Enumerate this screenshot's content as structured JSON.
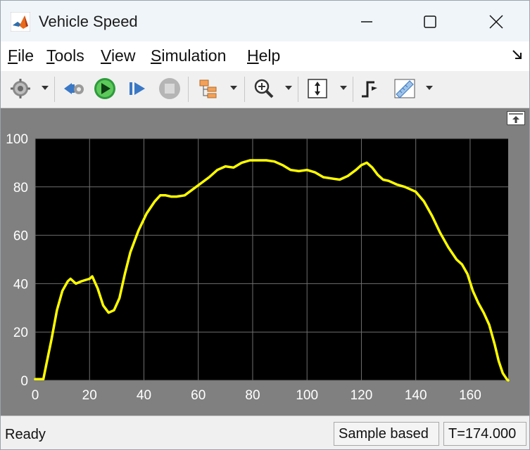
{
  "window": {
    "title": "Vehicle Speed"
  },
  "menu": [
    {
      "pre": "",
      "key": "F",
      "post": "ile"
    },
    {
      "pre": "",
      "key": "T",
      "post": "ools"
    },
    {
      "pre": "",
      "key": "V",
      "post": "iew"
    },
    {
      "pre": "",
      "key": "S",
      "post": "imulation"
    },
    {
      "pre": "",
      "key": "H",
      "post": "elp"
    }
  ],
  "toolbar": {
    "items": [
      "gear-icon",
      "step-back-icon",
      "run-icon",
      "step-forward-icon",
      "stop-icon",
      "signal-hierarchy-icon",
      "zoom-icon",
      "autoscale-icon",
      "trigger-icon",
      "measure-icon"
    ]
  },
  "status": {
    "ready": "Ready",
    "sample": "Sample based",
    "time": "T=174.000"
  },
  "colors": {
    "trace": "#ffff00",
    "plot_bg": "#000000",
    "scope_bg": "#808080",
    "grid": "#6f6f6f"
  },
  "chart_data": {
    "type": "line",
    "title": "",
    "xlabel": "",
    "ylabel": "",
    "xlim": [
      0,
      174
    ],
    "ylim": [
      0,
      100
    ],
    "xticks": [
      0,
      20,
      40,
      60,
      80,
      100,
      120,
      140,
      160
    ],
    "yticks": [
      0,
      20,
      40,
      60,
      80,
      100
    ],
    "grid": true,
    "series": [
      {
        "x": [
          0,
          3,
          4,
          6,
          8,
          10,
          12,
          13,
          15,
          17,
          20,
          21,
          23,
          25,
          27,
          29,
          31,
          33,
          35,
          38,
          41,
          44,
          46,
          48,
          50,
          52,
          55,
          58,
          61,
          64,
          67,
          70,
          73,
          76,
          79,
          82,
          85,
          88,
          91,
          94,
          97,
          100,
          103,
          106,
          109,
          112,
          115,
          118,
          120,
          122,
          124,
          126,
          128,
          130,
          133,
          136,
          140,
          143,
          146,
          149,
          152,
          155,
          157,
          159,
          161,
          163,
          165,
          167,
          169,
          170.5,
          172,
          173.5,
          174
        ],
        "y": [
          0.5,
          0.5,
          6,
          17,
          29,
          37,
          41,
          42,
          40,
          41,
          42,
          43,
          38,
          31,
          28,
          29,
          34,
          44,
          53,
          62,
          69,
          74,
          76.5,
          76.5,
          76,
          76,
          76.5,
          79,
          81.5,
          84,
          87,
          88.5,
          88,
          90,
          91,
          91,
          91,
          90.5,
          89,
          87,
          86.5,
          87,
          86,
          84,
          83.5,
          83,
          84.5,
          87,
          89,
          90,
          88,
          85,
          83,
          82.5,
          81,
          80,
          78,
          74,
          68,
          61,
          55,
          50,
          48,
          44,
          37,
          32,
          28,
          23,
          15,
          8,
          3,
          0.5,
          0
        ]
      }
    ]
  }
}
